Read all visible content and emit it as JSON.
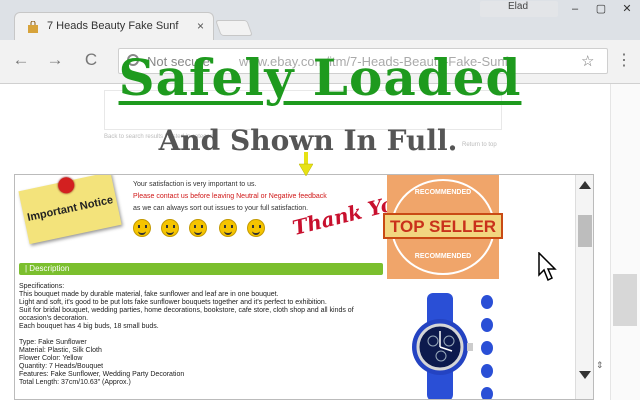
{
  "browser": {
    "tab_title": "7 Heads Beauty Fake Sunf",
    "tab_close": "×",
    "profile_name": "Elad",
    "window_buttons": [
      "–",
      "▢",
      "✕"
    ],
    "nav": {
      "back": "←",
      "forward": "→",
      "reload": "C"
    },
    "security_label": "Not secure",
    "url": "www.ebay.com/itm/7-Heads-Beauty-Fake-Sunf",
    "star": "☆",
    "menu": "⋮"
  },
  "background_page": {
    "back_link": "Back to search results | Listed in category:",
    "return_link": "Return to top"
  },
  "overlay": {
    "headline": "Safely Loaded",
    "subheadline": "And Shown In Full.",
    "accent_color": "#1e9a1e"
  },
  "description_frame": {
    "note": "Important Notice",
    "satisfaction": [
      "Your satisfaction is very important to us.",
      "Please contact us before leaving Neutral or Negative feedback",
      "as we can always sort out issues to your full satisfaction."
    ],
    "thank_you": "Thank You!",
    "badge": {
      "top": "RECOMMENDED",
      "main": "TOP SELLER",
      "bottom": "RECOMMENDED"
    },
    "section_label": "| Description",
    "details": [
      "Specifications:",
      "This bouquet made by durable material, fake sunflower and leaf are in one bouquet.",
      "Light and soft, it's good to be put lots fake sunflower bouquets together and it's perfect to exhibition.",
      "Suit for bridal bouquet, wedding parties, home decorations, bookstore, cafe store, cloth shop and all kinds of",
      "occasion's decoration.",
      "Each bouquet has 4 big buds, 18 small buds.",
      "",
      "Type: Fake Sunflower",
      "Material: Plastic, Silk Cloth",
      "Flower Color: Yellow",
      "Quantity: 7 Heads/Bouquet",
      "Features: Fake Sunflower, Wedding Party Decoration",
      "Total Length: 37cm/10.63\" (Approx.)"
    ],
    "smiley_count": 5
  }
}
